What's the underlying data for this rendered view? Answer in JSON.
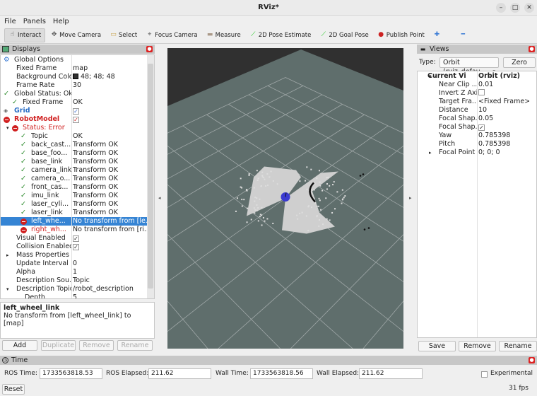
{
  "window": {
    "title": "RViz*"
  },
  "menu": [
    "File",
    "Panels",
    "Help"
  ],
  "toolbar": [
    {
      "label": "Interact",
      "icon": "hand-pointer-icon",
      "active": true
    },
    {
      "label": "Move Camera",
      "icon": "move-camera-icon"
    },
    {
      "label": "Select",
      "icon": "select-icon"
    },
    {
      "label": "Focus Camera",
      "icon": "focus-camera-icon"
    },
    {
      "label": "Measure",
      "icon": "ruler-icon"
    },
    {
      "label": "2D Pose Estimate",
      "icon": "green-arrow-icon"
    },
    {
      "label": "2D Goal Pose",
      "icon": "green-arrow-icon"
    },
    {
      "label": "Publish Point",
      "icon": "map-pin-icon"
    }
  ],
  "displays": {
    "title": "Displays",
    "rows": [
      {
        "name": "Global Options",
        "value": "",
        "indent": 0,
        "icon": "gear"
      },
      {
        "name": "Fixed Frame",
        "value": "map",
        "indent": 1
      },
      {
        "name": "Background Color",
        "value": "48; 48; 48",
        "indent": 1,
        "swatch": "#303030"
      },
      {
        "name": "Frame Rate",
        "value": "30",
        "indent": 1
      },
      {
        "name": "Global Status: Ok",
        "value": "",
        "indent": 0,
        "icon": "ok"
      },
      {
        "name": "Fixed Frame",
        "value": "OK",
        "indent": 1,
        "icon": "ok"
      },
      {
        "name": "Grid",
        "value": "",
        "indent": 0,
        "icon": "grid",
        "style": "blue",
        "check": true
      },
      {
        "name": "RobotModel",
        "value": "",
        "indent": 0,
        "icon": "err",
        "style": "red",
        "check": true
      },
      {
        "name": "Status: Error",
        "value": "",
        "indent": 1,
        "icon": "err",
        "style": "red",
        "expand": true
      },
      {
        "name": "Topic",
        "value": "OK",
        "indent": 2,
        "icon": "ok"
      },
      {
        "name": "back_cast...",
        "value": "Transform OK",
        "indent": 2,
        "icon": "ok"
      },
      {
        "name": "base_foo...",
        "value": "Transform OK",
        "indent": 2,
        "icon": "ok"
      },
      {
        "name": "base_link",
        "value": "Transform OK",
        "indent": 2,
        "icon": "ok"
      },
      {
        "name": "camera_link",
        "value": "Transform OK",
        "indent": 2,
        "icon": "ok"
      },
      {
        "name": "camera_o...",
        "value": "Transform OK",
        "indent": 2,
        "icon": "ok"
      },
      {
        "name": "front_cas...",
        "value": "Transform OK",
        "indent": 2,
        "icon": "ok"
      },
      {
        "name": "imu_link",
        "value": "Transform OK",
        "indent": 2,
        "icon": "ok"
      },
      {
        "name": "laser_cyli...",
        "value": "Transform OK",
        "indent": 2,
        "icon": "ok"
      },
      {
        "name": "laser_link",
        "value": "Transform OK",
        "indent": 2,
        "icon": "ok"
      },
      {
        "name": "left_whe...",
        "value": "No transform from [le...",
        "indent": 2,
        "icon": "err",
        "selected": true
      },
      {
        "name": "right_wh...",
        "value": "No transform from [ri...",
        "indent": 2,
        "icon": "err",
        "style": "red"
      },
      {
        "name": "Visual Enabled",
        "value": "",
        "indent": 1,
        "check": true
      },
      {
        "name": "Collision Enabled",
        "value": "",
        "indent": 1,
        "check": true
      },
      {
        "name": "Mass Properties",
        "value": "",
        "indent": 1,
        "collapsed": true
      },
      {
        "name": "Update Interval",
        "value": "0",
        "indent": 1
      },
      {
        "name": "Alpha",
        "value": "1",
        "indent": 1
      },
      {
        "name": "Description Sou...",
        "value": "Topic",
        "indent": 1
      },
      {
        "name": "Description Topic",
        "value": "/robot_description",
        "indent": 1,
        "expand": true
      },
      {
        "name": "Depth",
        "value": "5",
        "indent": 2
      }
    ],
    "description": {
      "title": "left_wheel_link",
      "text": "No transform from [left_wheel_link] to [map]"
    },
    "buttons": {
      "add": "Add",
      "duplicate": "Duplicate",
      "remove": "Remove",
      "rename": "Rename"
    }
  },
  "views": {
    "title": "Views",
    "type_label": "Type:",
    "type_value": "Orbit (rviz_defau",
    "zero": "Zero",
    "rows": [
      {
        "name": "Current View",
        "value": "Orbit (rviz)",
        "bold": true,
        "expand": true
      },
      {
        "name": "Near Clip ...",
        "value": "0.01"
      },
      {
        "name": "Invert Z Axis",
        "value": "",
        "check": false
      },
      {
        "name": "Target Fra...",
        "value": "<Fixed Frame>"
      },
      {
        "name": "Distance",
        "value": "10"
      },
      {
        "name": "Focal Shap...",
        "value": "0.05"
      },
      {
        "name": "Focal Shap...",
        "value": "",
        "check": true
      },
      {
        "name": "Yaw",
        "value": "0.785398"
      },
      {
        "name": "Pitch",
        "value": "0.785398"
      },
      {
        "name": "Focal Point",
        "value": "0; 0; 0",
        "collapsed": true
      }
    ],
    "buttons": {
      "save": "Save",
      "remove": "Remove",
      "rename": "Rename"
    }
  },
  "time": {
    "title": "Time",
    "ros_time_label": "ROS Time:",
    "ros_time": "1733563818.53",
    "ros_elapsed_label": "ROS Elapsed:",
    "ros_elapsed": "211.62",
    "wall_time_label": "Wall Time:",
    "wall_time": "1733563818.56",
    "wall_elapsed_label": "Wall Elapsed:",
    "wall_elapsed": "211.62",
    "experimental": "Experimental",
    "reset": "Reset",
    "fps": "31 fps"
  },
  "viewport": {
    "background": "#303030",
    "floor": "#5f6e6c",
    "grid_color": "#a0a8a8",
    "robot_color": "#3a3ad0"
  }
}
